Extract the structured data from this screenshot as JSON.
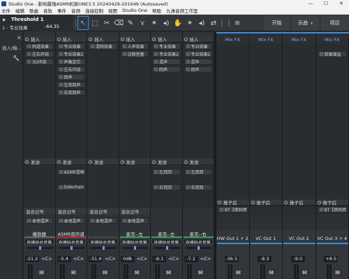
{
  "window": {
    "title": "Studio One - 影响最强ASMR机架ONE3.5 20240429-201649 (Autosaved)",
    "min": "—",
    "max": "☐",
    "close": "✕"
  },
  "menu": [
    "文件",
    "编辑",
    "歌曲",
    "音轨",
    "事件",
    "音频",
    "连接控制",
    "视图",
    "Studio One",
    "帮助",
    "九滩音频工作室"
  ],
  "toolbar": {
    "track_name": "Threshold 1",
    "track_sub": "1 - 专业效果",
    "track_value": "-64.35",
    "tabs": [
      {
        "label": "开始"
      },
      {
        "label": "乐曲",
        "chev": "▾"
      },
      {
        "label": "项目"
      }
    ]
  },
  "left": {
    "label": "插入/输...",
    "close": "✕",
    "wrench": "🔧"
  },
  "channels": [
    {
      "insert_header": "插入",
      "inserts": [
        "同道效果",
        "左右环绕",
        "3D环绕"
      ],
      "send_header": "发送",
      "sends": [],
      "recall": "混合记号",
      "recall_slot": "本地混声",
      "label": "播放器",
      "out": "直播码总音量",
      "vol": "-21.2",
      "pan": "<C>",
      "mute": "M",
      "bar": "#666"
    },
    {
      "insert_header": "插入",
      "inserts": [
        "专业效果",
        "专业效果2",
        "声像定位",
        "左右环绕",
        "回声",
        "左耳回声",
        "右耳回声"
      ],
      "send_header": "发送",
      "sends": [
        "ASMR混响",
        "Sidechain"
      ],
      "recall": "混合记号",
      "recall_slot": "本地混声",
      "label": "ASMR双声道",
      "out": "直播码总音量",
      "vol": "-5.4",
      "pan": "<C>",
      "mute": "M",
      "bar": "#c03030"
    },
    {
      "insert_header": "插入",
      "inserts": [
        "混响效果"
      ],
      "send_header": "发送",
      "sends": [],
      "recall": "混合记号",
      "recall_slot": "本地混声",
      "label": "",
      "out": "直播码总音量",
      "vol": "-31.4",
      "pan": "<C>",
      "mute": "M",
      "bar": "#444"
    },
    {
      "insert_header": "插入",
      "inserts": [
        "人声效果",
        "话筒音量"
      ],
      "send_header": "发送",
      "sends": [],
      "recall": "混合记号",
      "recall_slot": "本地混声",
      "label": "麦克--左",
      "out": "直播码总音量",
      "vol": "0dB",
      "pan": "<C>",
      "mute": "M",
      "bar": "#3aa050"
    },
    {
      "insert_header": "插入",
      "inserts": [
        "专业效果",
        "专业效果2",
        "混声",
        "回声"
      ],
      "send_header": "发送",
      "sends": [
        "左耳回",
        "右耳回"
      ],
      "recall": "",
      "recall_slot": "",
      "label": "麦克--左",
      "out": "直播码总音量",
      "vol": "-6.1",
      "pan": "<C>",
      "mute": "M",
      "bar": "#3aa050"
    },
    {
      "insert_header": "插入",
      "inserts": [
        "专业效果",
        "专业效果2",
        "混声",
        "回声"
      ],
      "send_header": "发送",
      "sends": [
        "左耳回",
        "右耳回"
      ],
      "recall": "",
      "recall_slot": "",
      "label": "麦克--右",
      "out": "直播码总音量",
      "vol": "-7.2",
      "pan": "<C>",
      "mute": "M",
      "bar": "#3aa050"
    }
  ],
  "mixfx": [
    {
      "label": "Mix FX",
      "inserts": [],
      "post": "推子后",
      "post_slot": "BT【串码西...",
      "name": "HW Out 1 + 2",
      "vol": "-36.5",
      "mute": "M"
    },
    {
      "label": "Mix FX",
      "inserts": [],
      "post": "推子后",
      "post_slot": "",
      "name": "VC Out 1",
      "vol": "-8.3",
      "mute": "M"
    },
    {
      "label": "Mix FX",
      "inserts": [],
      "post": "推子后",
      "post_slot": "",
      "name": "VC Out 2",
      "vol": "-9.0",
      "mute": "M"
    },
    {
      "label": "Mix FX",
      "inserts": [
        "效果增益"
      ],
      "post": "推子后",
      "post_slot": "BT【串码西...",
      "name": "VC Out 3 + 4",
      "vol": "+8.5",
      "mute": "M"
    }
  ]
}
